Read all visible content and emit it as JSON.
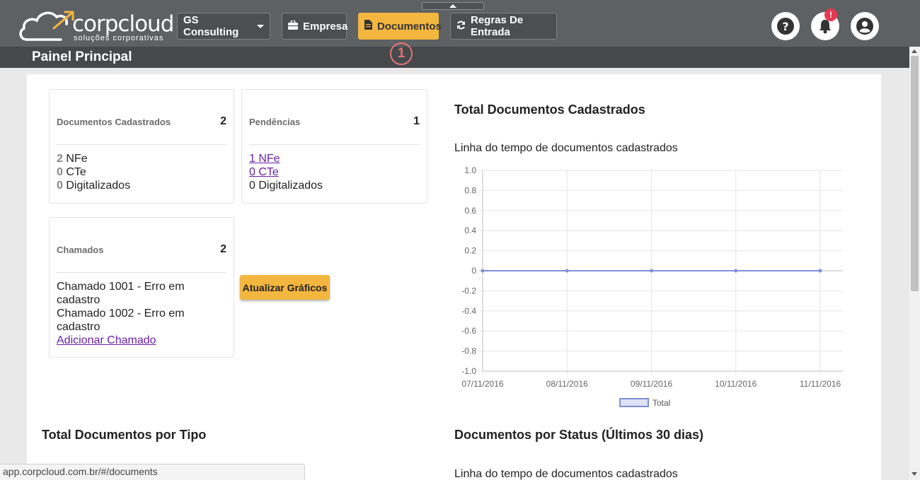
{
  "brand": {
    "name": "corpcloud",
    "tagline": "soluções corporativas"
  },
  "nav": {
    "company_select": "GS Consulting",
    "empresa": "Empresa",
    "documentos": "Documentos",
    "regras": "Regras De Entrada"
  },
  "notifications": {
    "badge": "!"
  },
  "page_title": "Painel Principal",
  "step_marker": "1",
  "cards": {
    "docs": {
      "label": "Documentos Cadastrados",
      "count": "2",
      "nfe_num": "2",
      "nfe_text": "NFe",
      "cte_num": "0",
      "cte_text": "CTe",
      "dig_num": "0",
      "dig_text": "Digitalizados"
    },
    "pend": {
      "label": "Pendências",
      "count": "1",
      "nfe": "1 NFe",
      "cte": "0 CTe",
      "dig": "0 Digitalizados"
    },
    "chamados": {
      "label": "Chamados",
      "count": "2",
      "item1": "Chamado 1001 - Erro em cadastro",
      "item2": "Chamado 1002 - Erro em cadastro",
      "add": "Adicionar Chamado"
    }
  },
  "update_button": "Atualizar Gráficos",
  "sections": {
    "total_docs": "Total Documentos Cadastrados",
    "total_tipo": "Total Documentos por Tipo",
    "status": "Documentos por Status (Últimos 30 dias)",
    "status_sub": "Linha do tempo de documentos cadastrados"
  },
  "chart_data": {
    "type": "line",
    "title": "Linha do tempo de documentos cadastrados",
    "x": [
      "07/11/2016",
      "08/11/2016",
      "09/11/2016",
      "10/11/2016",
      "11/11/2016"
    ],
    "series": [
      {
        "name": "Total",
        "values": [
          0,
          0,
          0,
          0,
          0
        ],
        "color": "#7f8fd9"
      }
    ],
    "ylim": [
      -1.0,
      1.0
    ],
    "yticks": [
      "1.0",
      "0.8",
      "0.6",
      "0.4",
      "0.2",
      "0",
      "-0.2",
      "-0.4",
      "-0.6",
      "-0.8",
      "-1.0"
    ],
    "grid": true,
    "legend": "bottom"
  },
  "status_url": "app.corpcloud.com.br/#/documents"
}
